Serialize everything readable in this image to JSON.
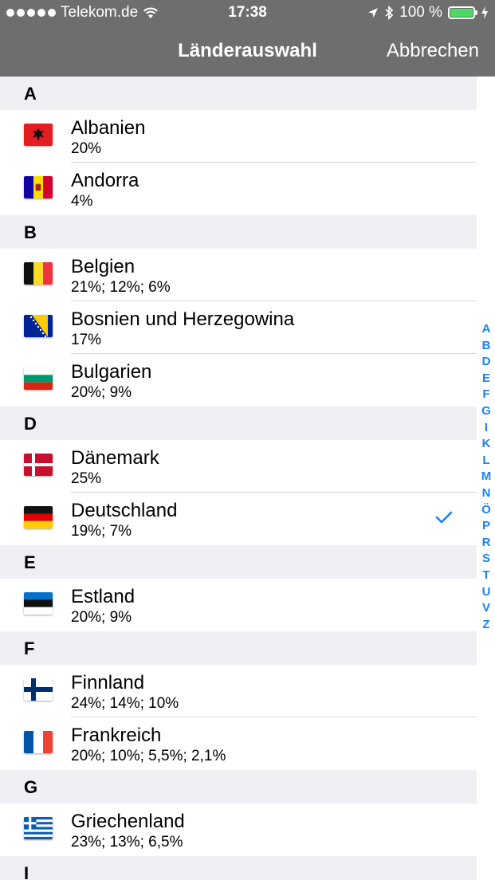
{
  "status": {
    "carrier": "Telekom.de",
    "time": "17:38",
    "battery": "100 %",
    "battery_level": 100,
    "battery_color": "#4cd964"
  },
  "nav": {
    "title": "Länderauswahl",
    "cancel": "Abbrechen"
  },
  "colors": {
    "bar": "#6e6e6e",
    "section_bg": "#efeff4",
    "accent": "#1a82f7"
  },
  "sections": [
    {
      "letter": "A",
      "items": [
        {
          "name": "Albanien",
          "rates": "20%",
          "flag": "albania-flag"
        },
        {
          "name": "Andorra",
          "rates": "4%",
          "flag": "andorra-flag"
        }
      ]
    },
    {
      "letter": "B",
      "items": [
        {
          "name": "Belgien",
          "rates": "21%; 12%; 6%",
          "flag": "belgium-flag"
        },
        {
          "name": "Bosnien und Herzegowina",
          "rates": "17%",
          "flag": "bosnia-flag"
        },
        {
          "name": "Bulgarien",
          "rates": "20%; 9%",
          "flag": "bulgaria-flag"
        }
      ]
    },
    {
      "letter": "D",
      "items": [
        {
          "name": "Dänemark",
          "rates": "25%",
          "flag": "denmark-flag"
        },
        {
          "name": "Deutschland",
          "rates": "19%; 7%",
          "flag": "germany-flag",
          "selected": true
        }
      ]
    },
    {
      "letter": "E",
      "items": [
        {
          "name": "Estland",
          "rates": "20%; 9%",
          "flag": "estonia-flag"
        }
      ]
    },
    {
      "letter": "F",
      "items": [
        {
          "name": "Finnland",
          "rates": "24%; 14%; 10%",
          "flag": "finland-flag"
        },
        {
          "name": "Frankreich",
          "rates": "20%; 10%; 5,5%; 2,1%",
          "flag": "france-flag"
        }
      ]
    },
    {
      "letter": "G",
      "items": [
        {
          "name": "Griechenland",
          "rates": "23%; 13%; 6,5%",
          "flag": "greece-flag"
        }
      ]
    },
    {
      "letter": "I",
      "items": []
    }
  ],
  "index_letters": [
    "A",
    "B",
    "D",
    "E",
    "F",
    "G",
    "I",
    "K",
    "L",
    "M",
    "N",
    "Ö",
    "P",
    "R",
    "S",
    "T",
    "U",
    "V",
    "Z"
  ]
}
